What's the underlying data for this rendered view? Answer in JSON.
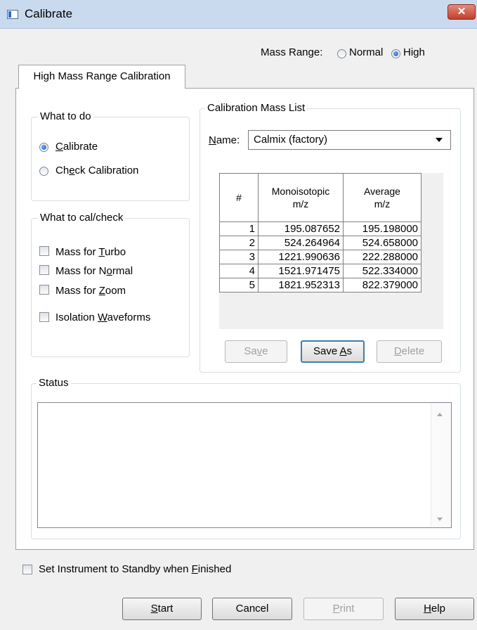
{
  "window": {
    "title": "Calibrate",
    "close_glyph": "✕",
    "icon": "app-window-icon"
  },
  "mass_range": {
    "label": "Mass Range:",
    "options": [
      {
        "label": "Normal",
        "selected": false
      },
      {
        "label": "High",
        "selected": true
      }
    ]
  },
  "tab": {
    "label": "High Mass Range Calibration"
  },
  "what_to_do": {
    "title": "What to do",
    "calibrate": {
      "pre": "",
      "key": "C",
      "post": "alibrate",
      "selected": true
    },
    "check_calibration": {
      "pre": "Ch",
      "key": "e",
      "post": "ck Calibration",
      "selected": false
    }
  },
  "what_to_cal": {
    "title": "What to cal/check",
    "items": [
      {
        "pre": "Mass for ",
        "key": "T",
        "post": "urbo",
        "checked": false
      },
      {
        "pre": "Mass for N",
        "key": "o",
        "post": "rmal",
        "checked": false
      },
      {
        "pre": "Mass for ",
        "key": "Z",
        "post": "oom",
        "checked": false
      },
      {
        "pre": "Isolation ",
        "key": "W",
        "post": "aveforms",
        "checked": false
      }
    ]
  },
  "mass_list": {
    "title": "Calibration Mass List",
    "name_label": {
      "pre": "",
      "key": "N",
      "post": "ame:"
    },
    "name_value": "Calmix (factory)",
    "columns": [
      "#",
      "Monoisotopic m/z",
      "Average m/z"
    ],
    "rows": [
      {
        "n": "1",
        "mono": "195.087652",
        "avg": "195.198000"
      },
      {
        "n": "2",
        "mono": "524.264964",
        "avg": "524.658000"
      },
      {
        "n": "3",
        "mono": "1221.990636",
        "avg": "222.288000"
      },
      {
        "n": "4",
        "mono": "1521.971475",
        "avg": "522.334000"
      },
      {
        "n": "5",
        "mono": "1821.952313",
        "avg": "822.379000"
      }
    ],
    "buttons": {
      "save": {
        "pre": "Sa",
        "key": "v",
        "post": "e"
      },
      "save_as": {
        "pre": "Save ",
        "key": "A",
        "post": "s"
      },
      "delete": {
        "pre": "",
        "key": "D",
        "post": "elete"
      }
    }
  },
  "status": {
    "title": "Status",
    "text": ""
  },
  "standby": {
    "pre": "Set Instrument to Standby when ",
    "key": "F",
    "post": "inished",
    "checked": false
  },
  "footer": {
    "start": {
      "pre": "",
      "key": "S",
      "post": "tart"
    },
    "cancel": {
      "label": "Cancel"
    },
    "print": {
      "pre": "",
      "key": "P",
      "post": "rint"
    },
    "help": {
      "pre": "",
      "key": "H",
      "post": "elp"
    }
  }
}
